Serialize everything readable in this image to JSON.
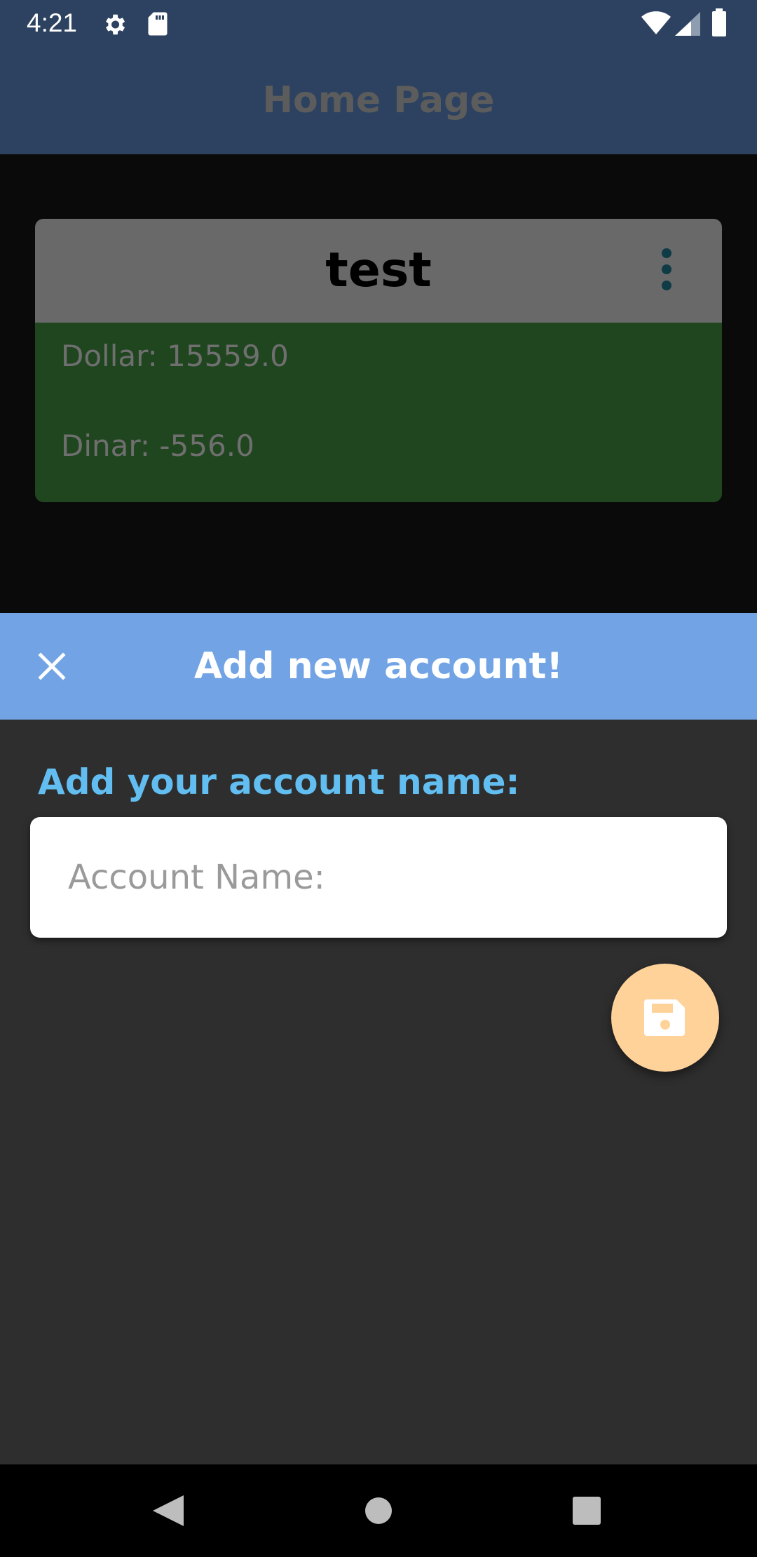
{
  "status_bar": {
    "time": "4:21",
    "icons": [
      "gear-icon",
      "sd-card-icon",
      "wifi-icon",
      "signal-icon",
      "battery-icon"
    ]
  },
  "app_bar": {
    "title": "Home Page"
  },
  "account_card": {
    "name": "test",
    "menu_icon": "more-vertical-icon",
    "balances": [
      {
        "label": "Dollar: 15559.0"
      },
      {
        "label": "Dinar: -556.0"
      }
    ]
  },
  "sheet": {
    "title": "Add new account!",
    "close_icon": "close-icon",
    "field_label": "Add your account name:",
    "input": {
      "value": "",
      "placeholder": "Account Name:"
    },
    "save_icon": "floppy-disk-icon"
  },
  "nav_bar": {
    "icons": [
      "back-icon",
      "home-icon",
      "recents-icon"
    ]
  },
  "colors": {
    "status_bar_bg": "#2d4260",
    "sheet_header_bg": "#72a4e5",
    "card_header_bg": "#696969",
    "card_body_bg": "#204620",
    "field_label": "#62bdf0",
    "fab_bg": "#ffd29a"
  }
}
